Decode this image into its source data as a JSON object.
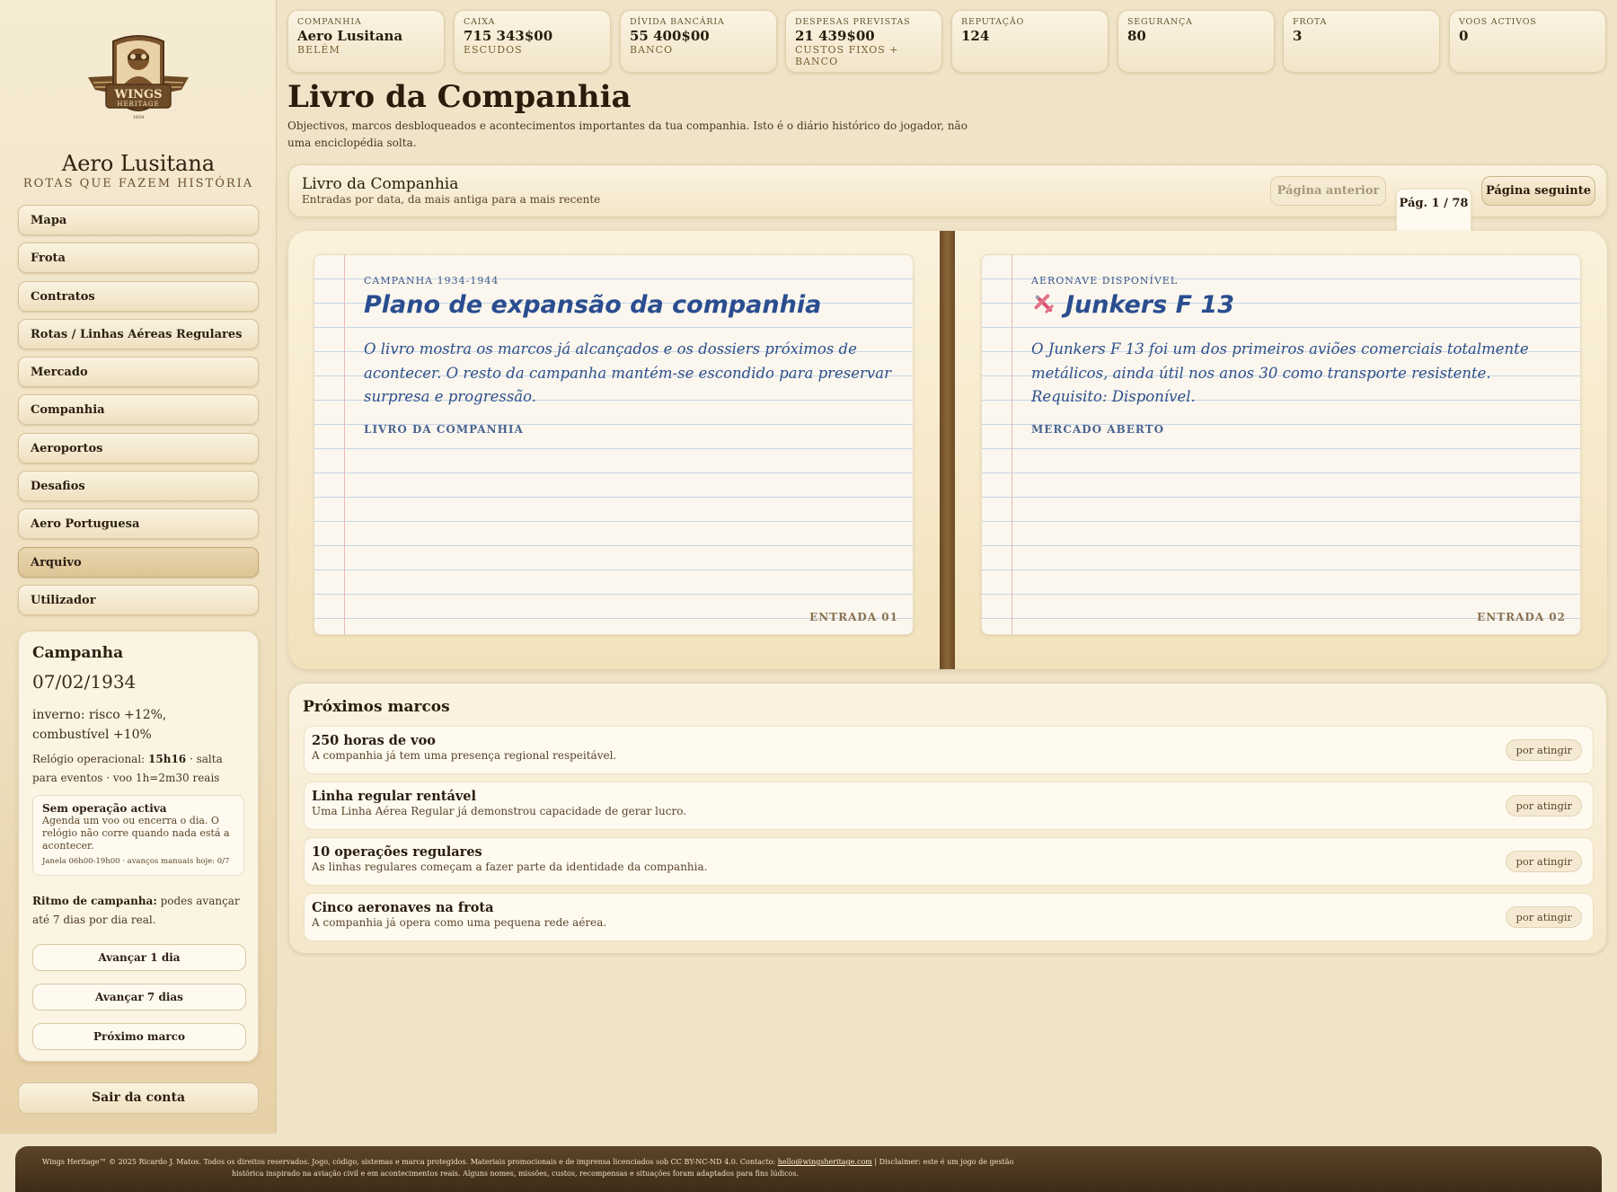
{
  "brand": {
    "name": "Aero Lusitana",
    "tagline": "ROTAS QUE FAZEM HISTÓRIA",
    "logo_text_top": "WINGS",
    "logo_text_bottom": "HERITAGE",
    "logo_year": "1934"
  },
  "nav": {
    "items": [
      {
        "label": "Mapa"
      },
      {
        "label": "Frota"
      },
      {
        "label": "Contratos"
      },
      {
        "label": "Rotas / Linhas Aéreas Regulares"
      },
      {
        "label": "Mercado"
      },
      {
        "label": "Companhia"
      },
      {
        "label": "Aeroportos"
      },
      {
        "label": "Desafios"
      },
      {
        "label": "Aero Portuguesa"
      },
      {
        "label": "Arquivo"
      },
      {
        "label": "Utilizador"
      }
    ],
    "active": "Arquivo"
  },
  "campaign": {
    "title": "Campanha",
    "date": "07/02/1934",
    "season": "inverno: risco +12%, combustível +10%",
    "clock_label": "Relógio operacional:",
    "clock_value": "15h16",
    "clock_note": "· salta para eventos · voo 1h=2m30 reais",
    "noop_title": "Sem operação activa",
    "noop_text": "Agenda um voo ou encerra o dia. O relógio não corre quando nada está a acontecer.",
    "noop_small": "Janela 06h00-19h00 · avanços manuais hoje: 0/7",
    "pace_label": "Ritmo de campanha:",
    "pace_text": "podes avançar até 7 dias por dia real.",
    "btn_1day": "Avançar 1 dia",
    "btn_7days": "Avançar 7 dias",
    "btn_next": "Próximo marco"
  },
  "logout_label": "Sair da conta",
  "stats": [
    {
      "label": "COMPANHIA",
      "value": "Aero Lusitana",
      "sub": "BELÉM"
    },
    {
      "label": "CAIXA",
      "value": "715 343$00",
      "sub": "ESCUDOS"
    },
    {
      "label": "DÍVIDA BANCÁRIA",
      "value": "55 400$00",
      "sub": "BANCO"
    },
    {
      "label": "DESPESAS PREVISTAS",
      "value": "21 439$00",
      "sub": "CUSTOS FIXOS + BANCO"
    },
    {
      "label": "REPUTAÇÃO",
      "value": "124",
      "sub": ""
    },
    {
      "label": "SEGURANÇA",
      "value": "80",
      "sub": ""
    },
    {
      "label": "FROTA",
      "value": "3",
      "sub": ""
    },
    {
      "label": "VOOS ACTIVOS",
      "value": "0",
      "sub": ""
    }
  ],
  "page": {
    "title": "Livro da Companhia",
    "description": "Objectivos, marcos desbloqueados e acontecimentos importantes da tua companhia. Isto é o diário histórico do jogador, não uma enciclopédia solta."
  },
  "book": {
    "title": "Livro da Companhia",
    "subtitle": "Entradas por data, da mais antiga para a mais recente",
    "prev_label": "Página anterior",
    "page_indicator": "Pág. 1 / 78",
    "next_label": "Página seguinte",
    "entries": [
      {
        "kicker": "CAMPANHA 1934-1944",
        "heading": "Plano de expansão da companhia",
        "body": "O livro mostra os marcos já alcançados e os dossiers próximos de acontecer. O resto da campanha mantém-se escondido para preservar surpresa e progressão.",
        "tag": "LIVRO DA COMPANHIA",
        "entry": "ENTRADA 01"
      },
      {
        "kicker": "AERONAVE DISPONÍVEL",
        "heading": "Junkers F 13",
        "icon": "airplane-icon",
        "body": "O Junkers F 13 foi um dos primeiros aviões comerciais totalmente metálicos, ainda útil nos anos 30 como transporte resistente. Requisito: Disponível.",
        "tag": "MERCADO ABERTO",
        "entry": "ENTRADA 02"
      }
    ]
  },
  "milestones": {
    "title": "Próximos marcos",
    "items": [
      {
        "name": "250 horas de voo",
        "desc": "A companhia já tem uma presença regional respeitável.",
        "status": "por atingir"
      },
      {
        "name": "Linha regular rentável",
        "desc": "Uma Linha Aérea Regular já demonstrou capacidade de gerar lucro.",
        "status": "por atingir"
      },
      {
        "name": "10 operações regulares",
        "desc": "As linhas regulares começam a fazer parte da identidade da companhia.",
        "status": "por atingir"
      },
      {
        "name": "Cinco aeronaves na frota",
        "desc": "A companhia já opera como uma pequena rede aérea.",
        "status": "por atingir"
      }
    ]
  },
  "footer": {
    "line1_a": "Wings Heritage™ © 2025 Ricardo J. Matos. Todos os direitos reservados. Jogo, código, sistemas e marca protegidos. Materiais promocionais e de imprensa licenciados sob CC BY-NC-ND 4.0. Contacto:",
    "email": "hello@wingsheritage.com",
    "line1_b": "| Disclaimer: este é um jogo de gestão",
    "line2": "histórica inspirado na aviação civil e em acontecimentos reais. Alguns nomes, missões, custos, recompensas e situações foram adaptados para fins lúdicos."
  },
  "colors": {
    "ink_blue": "#2a4d8f",
    "spine": "#7a5630",
    "footer": "#4a3520",
    "background": "#efe4c8"
  }
}
